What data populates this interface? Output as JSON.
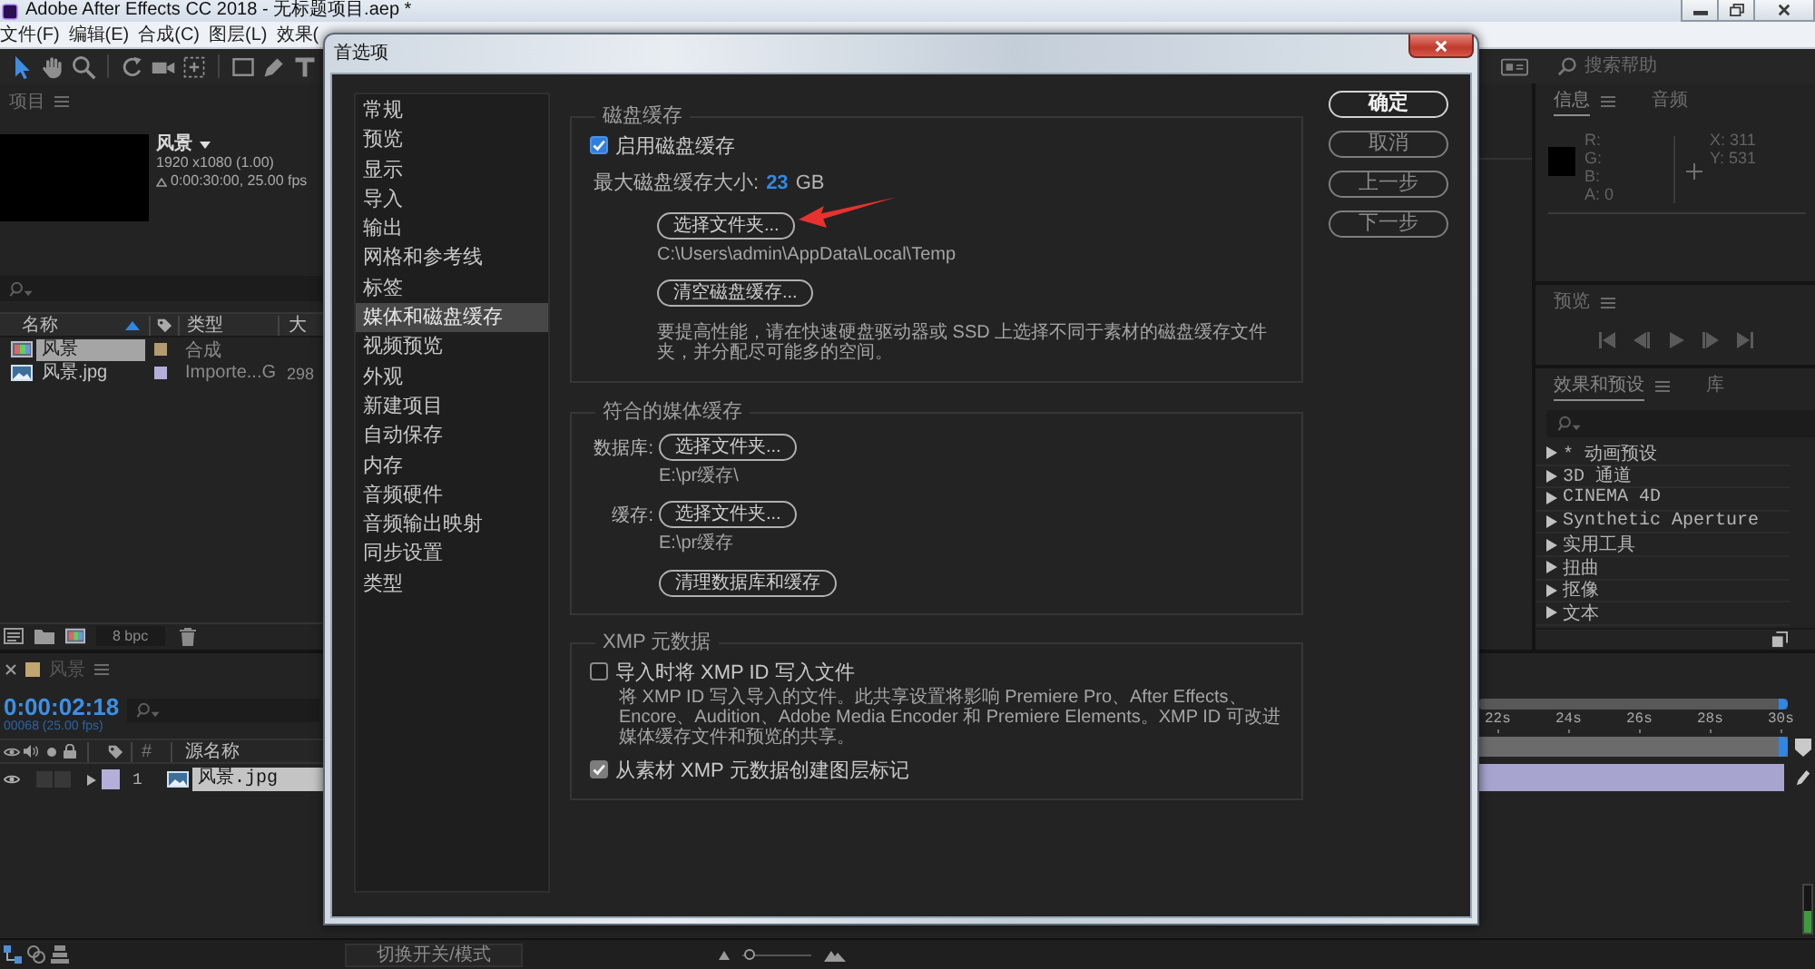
{
  "app_window": {
    "title": "Adobe After Effects CC 2018 - 无标题项目.aep *"
  },
  "menu_bar": [
    "文件(F)",
    "编辑(E)",
    "合成(C)",
    "图层(L)",
    "效果("
  ],
  "toolbar": {
    "tools": [
      {
        "kind": "selection",
        "selected": true
      },
      {
        "kind": "hand",
        "selected": false
      },
      {
        "kind": "zoom",
        "selected": false
      },
      {
        "kind": "rotate",
        "selected": false
      },
      {
        "kind": "camera",
        "selected": false
      },
      {
        "kind": "pan_behind",
        "selected": false
      },
      {
        "kind": "rectangle",
        "selected": false
      },
      {
        "kind": "pen",
        "selected": false
      },
      {
        "kind": "type",
        "selected": false
      }
    ],
    "search_placeholder": "搜索帮助"
  },
  "project_panel": {
    "tab": "项目",
    "item_name": "风景",
    "item_size": "1920 x1080 (1.00)",
    "item_duration": "0:00:30:00, 25.00 fps",
    "columns": [
      "名称",
      "类型",
      "大"
    ],
    "rows": [
      {
        "kind": "composition",
        "name": "风景",
        "color": "#b39c72",
        "type": "合成",
        "selected": true
      },
      {
        "kind": "image",
        "name": "风景.jpg",
        "color": "#b3afd9",
        "type": "Importe...G",
        "size": "298",
        "selected": false
      }
    ],
    "bit_depth": "8 bpc"
  },
  "timeline_panel": {
    "tab": "风景",
    "timecode": "0:00:02:18",
    "frame_info": "00068 (25.00 fps)",
    "columns": [
      "#",
      "源名称"
    ],
    "layers": [
      {
        "number": "1",
        "name": "风景.jpg",
        "color": "#b3afd9",
        "selected": true
      }
    ],
    "ruler_ticks": [
      "22s",
      "24s",
      "26s",
      "28s",
      "30s"
    ],
    "audio_meter": {
      "level": 0.45
    },
    "toggle_button": "切换开关/模式",
    "zoom_slider": {
      "level": 0.1
    }
  },
  "info_panel": {
    "tabs": [
      {
        "label": "信息",
        "selected": true
      },
      {
        "label": "音频",
        "selected": false
      }
    ],
    "channels": [
      "R:",
      "G:",
      "B:",
      "A: 0"
    ],
    "coordinates": [
      "X: 311",
      "Y: 531"
    ]
  },
  "preview_panel": {
    "tab": "预览"
  },
  "effects_panel": {
    "tabs": [
      {
        "label": "效果和预设",
        "selected": true
      },
      {
        "label": "库",
        "selected": false
      }
    ],
    "categories": [
      "* 动画预设",
      "3D 通道",
      "CINEMA 4D",
      "Synthetic Aperture",
      "实用工具",
      "扭曲",
      "抠像",
      "文本"
    ]
  },
  "dialog": {
    "title": "首选项",
    "categories": [
      {
        "label": "常规",
        "selected": false
      },
      {
        "label": "预览",
        "selected": false
      },
      {
        "label": "显示",
        "selected": false
      },
      {
        "label": "导入",
        "selected": false
      },
      {
        "label": "输出",
        "selected": false
      },
      {
        "label": "网格和参考线",
        "selected": false
      },
      {
        "label": "标签",
        "selected": false
      },
      {
        "label": "媒体和磁盘缓存",
        "selected": true
      },
      {
        "label": "视频预览",
        "selected": false
      },
      {
        "label": "外观",
        "selected": false
      },
      {
        "label": "新建项目",
        "selected": false
      },
      {
        "label": "自动保存",
        "selected": false
      },
      {
        "label": "内存",
        "selected": false
      },
      {
        "label": "音频硬件",
        "selected": false
      },
      {
        "label": "音频输出映射",
        "selected": false
      },
      {
        "label": "同步设置",
        "selected": false
      },
      {
        "label": "类型",
        "selected": false
      }
    ],
    "disk_cache": {
      "title": "磁盘缓存",
      "enable": {
        "label": "启用磁盘缓存",
        "checked": true,
        "focused": true
      },
      "max_size_label": "最大磁盘缓存大小:",
      "max_size_value": "23",
      "max_size_unit": "GB",
      "choose_button": "选择文件夹...",
      "path": "C:\\Users\\admin\\AppData\\Local\\Temp",
      "empty_button": "清空磁盘缓存...",
      "note": "要提高性能，请在快速硬盘驱动器或 SSD 上选择不同于素材的磁盘缓存文件夹，并分配尽可能多的空间。"
    },
    "media_cache": {
      "title": "符合的媒体缓存",
      "locations": [
        {
          "label": "数据库:",
          "button": "选择文件夹...",
          "path": "E:\\pr缓存\\"
        },
        {
          "label": "缓存:",
          "button": "选择文件夹...",
          "path": "E:\\pr缓存"
        }
      ],
      "clean_button": "清理数据库和缓存"
    },
    "xmp": {
      "title": "XMP 元数据",
      "options": [
        {
          "label": "导入时将 XMP ID 写入文件",
          "checked": false,
          "focused": false,
          "description": "将 XMP ID 写入导入的文件。此共享设置将影响 Premiere Pro、After Effects、Encore、Audition、Adobe Media Encoder 和 Premiere Elements。XMP ID 可改进媒体缓存文件和预览的共享。"
        },
        {
          "label": "从素材 XMP 元数据创建图层标记",
          "checked": true,
          "focused": false
        }
      ]
    },
    "buttons": [
      {
        "label": "确定",
        "default": true
      },
      {
        "label": "取消",
        "default": false
      },
      {
        "label": "上一步",
        "default": false
      },
      {
        "label": "下一步",
        "default": false
      }
    ]
  }
}
